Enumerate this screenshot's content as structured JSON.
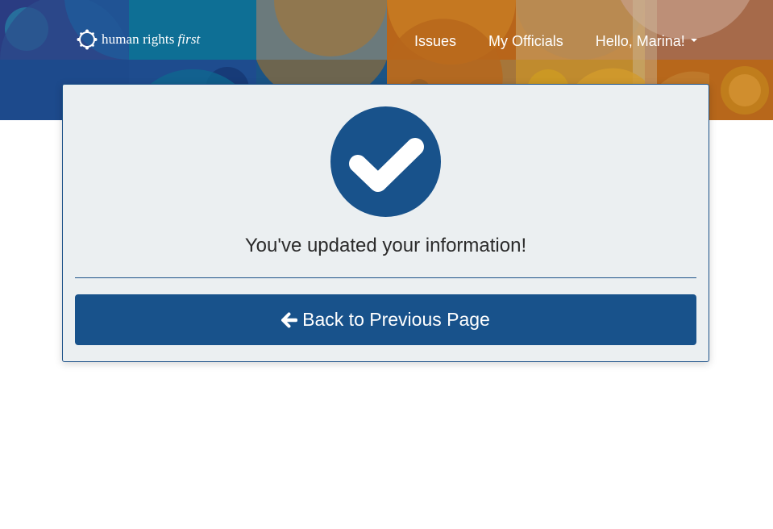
{
  "header": {
    "logo": {
      "name": "human rights",
      "name_emphasis": "first",
      "icon": "circle-dots-logo-icon"
    },
    "nav": {
      "issues_label": "Issues",
      "officials_label": "My Officials",
      "user_greeting": "Hello, Marina!",
      "user_menu_icon": "caret-down-icon"
    },
    "banner_colors": [
      "#1f3f7a",
      "#0b6a8f",
      "#b87b1f",
      "#a34f19",
      "#c59050",
      "#2a7da3"
    ]
  },
  "confirmation": {
    "icon": "checkmark-circle-icon",
    "message": "You've updated your information!",
    "back_button_label": "Back to Previous Page",
    "back_button_icon": "arrow-left-icon"
  },
  "colors": {
    "primary": "#18528b",
    "card_background": "#ebeff1",
    "text": "#2b2b2b"
  }
}
